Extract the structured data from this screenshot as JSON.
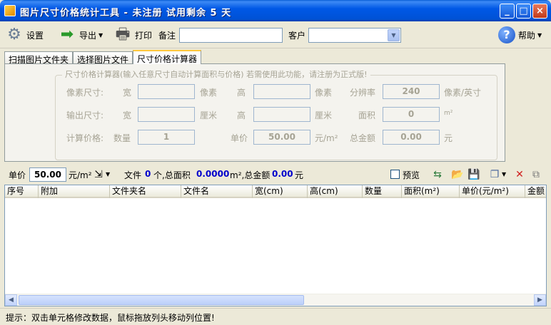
{
  "window": {
    "title": "图片尺寸价格统计工具 - 未注册 试用剩余 5 天"
  },
  "toolbar": {
    "settings": "设置",
    "export": "导出",
    "print": "打印",
    "note_label": "备注",
    "note_value": "",
    "client_label": "客户",
    "client_value": "",
    "help": "帮助"
  },
  "tabs": [
    {
      "label": "扫描图片文件夹"
    },
    {
      "label": "选择图片文件"
    },
    {
      "label": "尺寸价格计算器"
    }
  ],
  "calculator": {
    "group_title": "尺寸价格计算器(输入任意尺寸自动计算面积与价格)  若需使用此功能，请注册为正式版!",
    "pixel_label": "像素尺寸:",
    "width_label": "宽",
    "height_label": "高",
    "pixel_unit": "像素",
    "resolution_label": "分辨率",
    "resolution_value": "240",
    "resolution_unit": "像素/英寸",
    "output_label": "输出尺寸:",
    "cm_unit": "厘米",
    "area_label": "面积",
    "area_value": "0",
    "area_unit": "m²",
    "price_label": "计算价格:",
    "qty_label": "数量",
    "qty_value": "1",
    "unit_price_label": "单价",
    "unit_price_value": "50.00",
    "unit_price_unit": "元/m²",
    "total_label": "总金额",
    "total_value": "0.00",
    "total_unit": "元"
  },
  "summary": {
    "price_label": "单价",
    "price_value": "50.00",
    "price_unit": "元/m²",
    "files_label": "文件",
    "files_count": "0",
    "files_unit": "个,总面积",
    "area_value": "0.0000",
    "area_unit": "m²,总金额",
    "total_value": "0.00",
    "total_unit": "元",
    "preview_label": "预览"
  },
  "grid": {
    "columns": [
      "序号",
      "附加",
      "文件夹名",
      "文件名",
      "宽(cm)",
      "高(cm)",
      "数量",
      "面积(m²)",
      "单价(元/m²)",
      "金额"
    ]
  },
  "status": {
    "text": "提示：双击单元格修改数据，鼠标拖放列头移动列位置!"
  }
}
